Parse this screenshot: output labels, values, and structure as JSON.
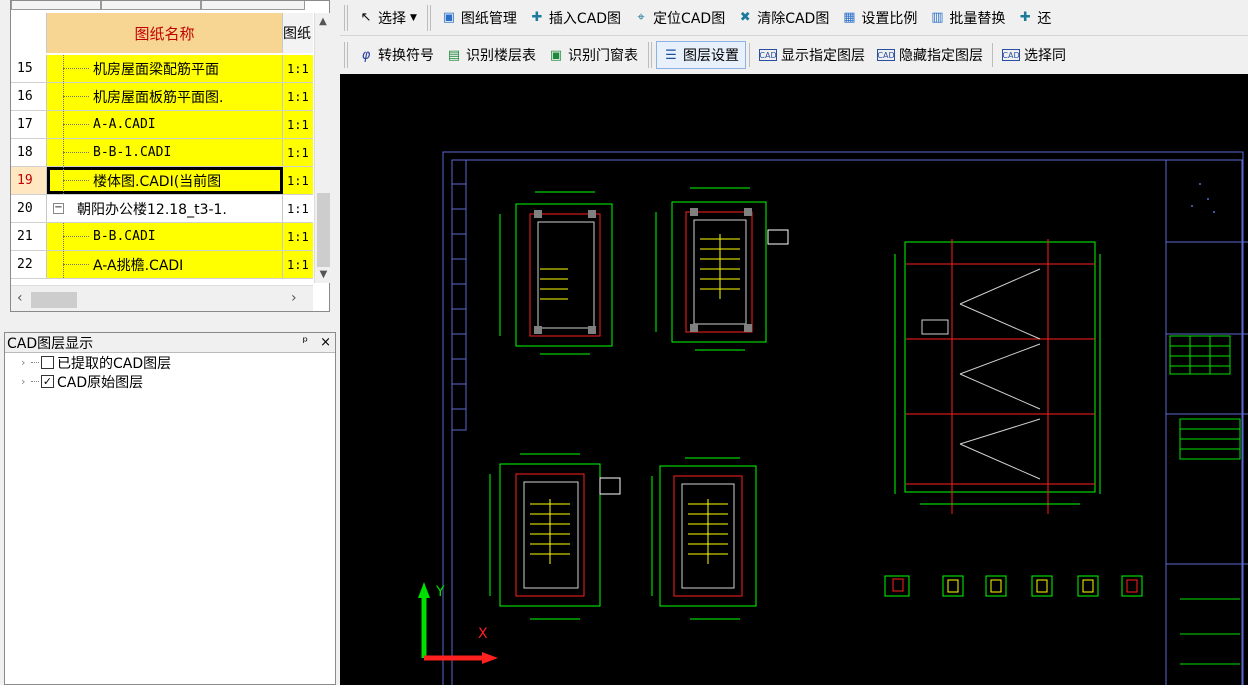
{
  "grid": {
    "header": {
      "name": "图纸名称",
      "scale": "图纸"
    },
    "rows": [
      {
        "num": "15",
        "name": "机房屋面梁配筋平面",
        "scale": "1:1"
      },
      {
        "num": "16",
        "name": "机房屋面板筋平面图.",
        "scale": "1:1"
      },
      {
        "num": "17",
        "name": "A-A.CADI",
        "scale": "1:1"
      },
      {
        "num": "18",
        "name": "B-B-1.CADI",
        "scale": "1:1"
      },
      {
        "num": "19",
        "name": "楼体图.CADI(当前图",
        "scale": "1:1"
      },
      {
        "num": "20",
        "name": "朝阳办公楼12.18_t3-1.",
        "scale": "1:1",
        "expander": "−"
      },
      {
        "num": "21",
        "name": "B-B.CADI",
        "scale": "1:1"
      },
      {
        "num": "22",
        "name": "A-A挑檐.CADI",
        "scale": "1:1"
      }
    ]
  },
  "layer_panel": {
    "title": "CAD图层显示",
    "pin": "ᵖ",
    "close": "×",
    "items": [
      {
        "label": "已提取的CAD图层",
        "checked": ""
      },
      {
        "label": "CAD原始图层",
        "checked": "✓"
      }
    ]
  },
  "toolbar1": {
    "select": "选择",
    "drawing_manage": "图纸管理",
    "insert_cad": "插入CAD图",
    "locate_cad": "定位CAD图",
    "clear_cad": "清除CAD图",
    "set_scale": "设置比例",
    "batch_replace": "批量替换",
    "more": "还"
  },
  "toolbar2": {
    "convert_symbol": "转换符号",
    "recognize_floor_table": "识别楼层表",
    "recognize_door_window_table": "识别门窗表",
    "layer_settings": "图层设置",
    "show_layer": "显示指定图层",
    "hide_layer": "隐藏指定图层",
    "select_same": "选择同"
  },
  "canvas": {
    "axis_y": "Y",
    "axis_x": "X"
  },
  "colors": {
    "row_highlight": "#ffff00",
    "header_bg": "#f7d694",
    "header_text": "#c00000",
    "cad_green": "#00ff00",
    "cad_red": "#ff2020",
    "cad_blue": "#5a6ad0",
    "canvas_bg": "#000000"
  }
}
